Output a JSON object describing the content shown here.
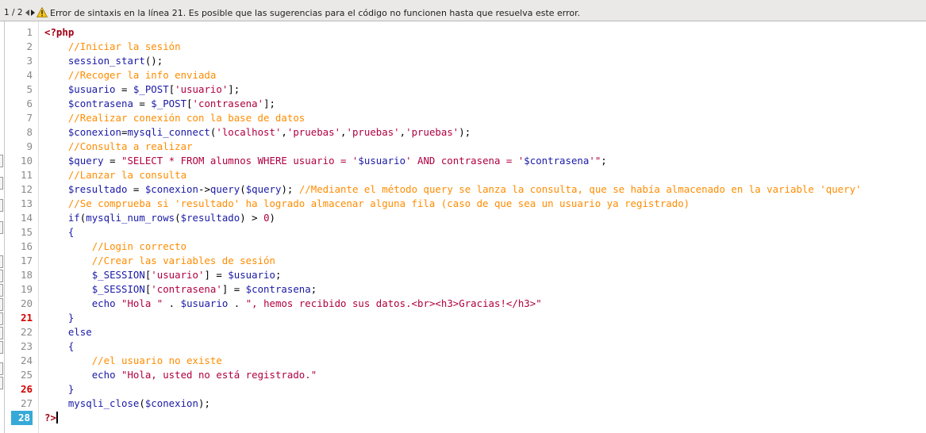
{
  "error_bar": {
    "counter": "1 / 2",
    "message": "Error de sintaxis en la línea 21. Es posible que las sugerencias para el código no funcionen hasta que resuelva este error."
  },
  "editor": {
    "current_line": 28,
    "error_lines": [
      21,
      26
    ],
    "line_numbers": [
      1,
      2,
      3,
      4,
      5,
      6,
      7,
      8,
      9,
      10,
      11,
      12,
      13,
      14,
      15,
      16,
      17,
      18,
      19,
      20,
      21,
      22,
      23,
      24,
      25,
      26,
      27,
      28
    ],
    "lines": [
      [
        {
          "t": "kw",
          "v": "<?php"
        }
      ],
      [
        {
          "t": "op",
          "v": "    "
        },
        {
          "t": "cm",
          "v": "//Iniciar la sesión"
        }
      ],
      [
        {
          "t": "op",
          "v": "    "
        },
        {
          "t": "fn",
          "v": "session_start"
        },
        {
          "t": "op",
          "v": "();"
        }
      ],
      [
        {
          "t": "op",
          "v": "    "
        },
        {
          "t": "cm",
          "v": "//Recoger la info enviada"
        }
      ],
      [
        {
          "t": "op",
          "v": "    "
        },
        {
          "t": "var",
          "v": "$usuario"
        },
        {
          "t": "op",
          "v": " = "
        },
        {
          "t": "var",
          "v": "$_POST"
        },
        {
          "t": "op",
          "v": "["
        },
        {
          "t": "str",
          "v": "'usuario'"
        },
        {
          "t": "op",
          "v": "];"
        }
      ],
      [
        {
          "t": "op",
          "v": "    "
        },
        {
          "t": "var",
          "v": "$contrasena"
        },
        {
          "t": "op",
          "v": " = "
        },
        {
          "t": "var",
          "v": "$_POST"
        },
        {
          "t": "op",
          "v": "["
        },
        {
          "t": "str",
          "v": "'contrasena'"
        },
        {
          "t": "op",
          "v": "];"
        }
      ],
      [
        {
          "t": "op",
          "v": "    "
        },
        {
          "t": "cm",
          "v": "//Realizar conexión con la base de datos"
        }
      ],
      [
        {
          "t": "op",
          "v": "    "
        },
        {
          "t": "var",
          "v": "$conexion"
        },
        {
          "t": "op",
          "v": "="
        },
        {
          "t": "fn",
          "v": "mysqli_connect"
        },
        {
          "t": "op",
          "v": "("
        },
        {
          "t": "str",
          "v": "'localhost'"
        },
        {
          "t": "op",
          "v": ","
        },
        {
          "t": "str",
          "v": "'pruebas'"
        },
        {
          "t": "op",
          "v": ","
        },
        {
          "t": "str",
          "v": "'pruebas'"
        },
        {
          "t": "op",
          "v": ","
        },
        {
          "t": "str",
          "v": "'pruebas'"
        },
        {
          "t": "op",
          "v": ");"
        }
      ],
      [
        {
          "t": "op",
          "v": "    "
        },
        {
          "t": "cm",
          "v": "//Consulta a realizar"
        }
      ],
      [
        {
          "t": "op",
          "v": "    "
        },
        {
          "t": "var",
          "v": "$query"
        },
        {
          "t": "op",
          "v": " = "
        },
        {
          "t": "str",
          "v": "\"SELECT * FROM alumnos WHERE usuario = '"
        },
        {
          "t": "var",
          "v": "$usuario"
        },
        {
          "t": "str",
          "v": "' AND contrasena = '"
        },
        {
          "t": "var",
          "v": "$contrasena"
        },
        {
          "t": "str",
          "v": "'\""
        },
        {
          "t": "op",
          "v": ";"
        }
      ],
      [
        {
          "t": "op",
          "v": "    "
        },
        {
          "t": "cm",
          "v": "//Lanzar la consulta"
        }
      ],
      [
        {
          "t": "op",
          "v": "    "
        },
        {
          "t": "var",
          "v": "$resultado"
        },
        {
          "t": "op",
          "v": " = "
        },
        {
          "t": "var",
          "v": "$conexion"
        },
        {
          "t": "op",
          "v": "->"
        },
        {
          "t": "fn",
          "v": "query"
        },
        {
          "t": "op",
          "v": "("
        },
        {
          "t": "var",
          "v": "$query"
        },
        {
          "t": "op",
          "v": "); "
        },
        {
          "t": "cm",
          "v": "//Mediante el método query se lanza la consulta, que se había almacenado en la variable 'query'"
        }
      ],
      [
        {
          "t": "op",
          "v": "    "
        },
        {
          "t": "cm",
          "v": "//Se comprueba si 'resultado' ha logrado almacenar alguna fila (caso de que sea un usuario ya registrado)"
        }
      ],
      [
        {
          "t": "op",
          "v": "    "
        },
        {
          "t": "fn",
          "v": "if"
        },
        {
          "t": "op",
          "v": "("
        },
        {
          "t": "fn",
          "v": "mysqli_num_rows"
        },
        {
          "t": "op",
          "v": "("
        },
        {
          "t": "var",
          "v": "$resultado"
        },
        {
          "t": "op",
          "v": ") > "
        },
        {
          "t": "str",
          "v": "0"
        },
        {
          "t": "op",
          "v": ")"
        }
      ],
      [
        {
          "t": "op",
          "v": "    "
        },
        {
          "t": "fn",
          "v": "{"
        }
      ],
      [
        {
          "t": "op",
          "v": "        "
        },
        {
          "t": "cm",
          "v": "//Login correcto"
        }
      ],
      [
        {
          "t": "op",
          "v": "        "
        },
        {
          "t": "cm",
          "v": "//Crear las variables de sesión"
        }
      ],
      [
        {
          "t": "op",
          "v": "        "
        },
        {
          "t": "var",
          "v": "$_SESSION"
        },
        {
          "t": "op",
          "v": "["
        },
        {
          "t": "str",
          "v": "'usuario'"
        },
        {
          "t": "op",
          "v": "] = "
        },
        {
          "t": "var",
          "v": "$usuario"
        },
        {
          "t": "op",
          "v": ";"
        }
      ],
      [
        {
          "t": "op",
          "v": "        "
        },
        {
          "t": "var",
          "v": "$_SESSION"
        },
        {
          "t": "op",
          "v": "["
        },
        {
          "t": "str",
          "v": "'contrasena'"
        },
        {
          "t": "op",
          "v": "] = "
        },
        {
          "t": "var",
          "v": "$contrasena"
        },
        {
          "t": "op",
          "v": ";"
        }
      ],
      [
        {
          "t": "op",
          "v": "        "
        },
        {
          "t": "fn",
          "v": "echo"
        },
        {
          "t": "op",
          "v": " "
        },
        {
          "t": "str",
          "v": "\"Hola \""
        },
        {
          "t": "op",
          "v": " . "
        },
        {
          "t": "var",
          "v": "$usuario"
        },
        {
          "t": "op",
          "v": " . "
        },
        {
          "t": "str",
          "v": "\", hemos recibido sus datos.<br><h3>Gracias!</h3>\""
        }
      ],
      [
        {
          "t": "op",
          "v": "    "
        },
        {
          "t": "fn",
          "v": "}"
        }
      ],
      [
        {
          "t": "op",
          "v": "    "
        },
        {
          "t": "fn",
          "v": "else"
        }
      ],
      [
        {
          "t": "op",
          "v": "    "
        },
        {
          "t": "fn",
          "v": "{"
        }
      ],
      [
        {
          "t": "op",
          "v": "        "
        },
        {
          "t": "cm",
          "v": "//el usuario no existe"
        }
      ],
      [
        {
          "t": "op",
          "v": "        "
        },
        {
          "t": "fn",
          "v": "echo"
        },
        {
          "t": "op",
          "v": " "
        },
        {
          "t": "str",
          "v": "\"Hola, usted no está registrado.\""
        }
      ],
      [
        {
          "t": "op",
          "v": "    "
        },
        {
          "t": "fn",
          "v": "}"
        }
      ],
      [
        {
          "t": "op",
          "v": "    "
        },
        {
          "t": "fn",
          "v": "mysqli_close"
        },
        {
          "t": "op",
          "v": "("
        },
        {
          "t": "var",
          "v": "$conexion"
        },
        {
          "t": "op",
          "v": ");"
        }
      ],
      [
        {
          "t": "kw",
          "v": "?>"
        }
      ]
    ]
  },
  "colors": {
    "comment": "#ff8c00",
    "string": "#b00040",
    "identifier": "#1a1aa6",
    "php_tag": "#a30015",
    "error_line_number": "#d20000",
    "current_line_highlight": "#37a9d8"
  }
}
